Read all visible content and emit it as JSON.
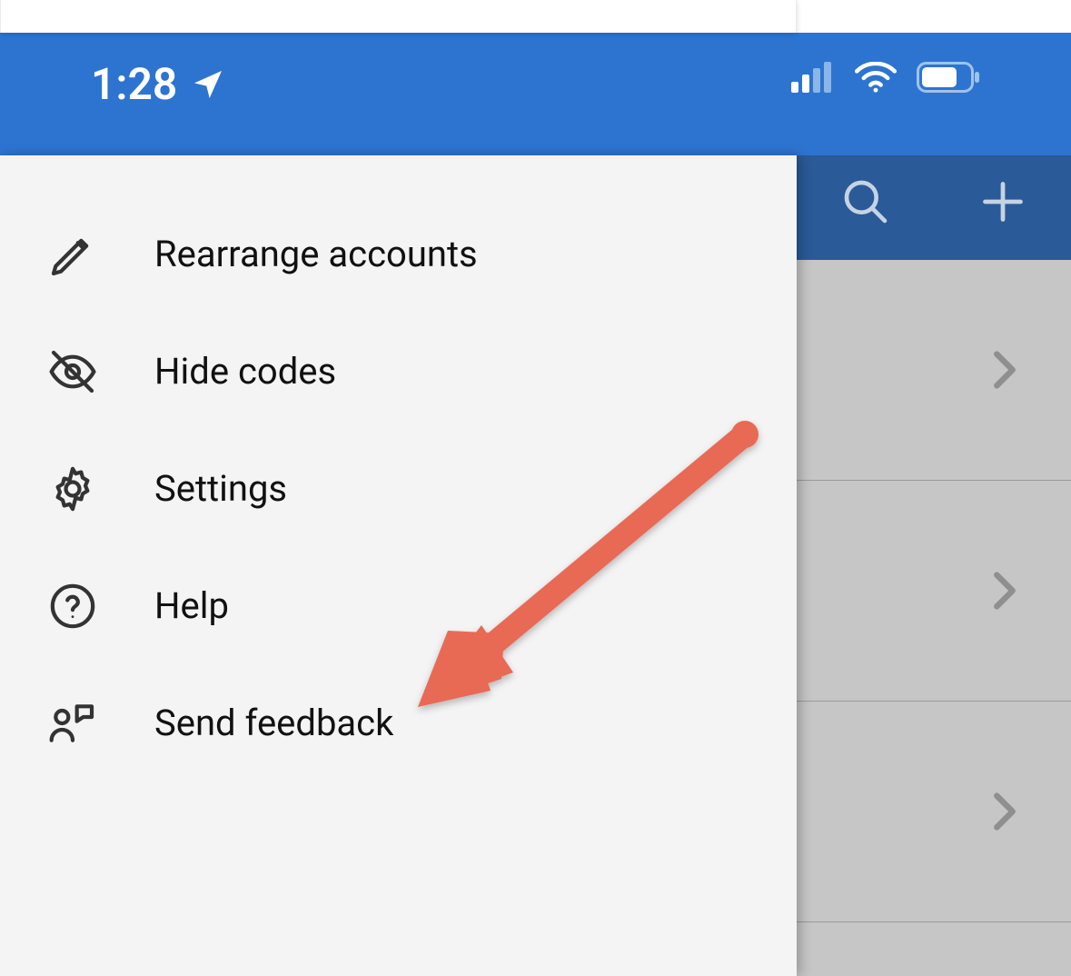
{
  "status_bar": {
    "time": "1:28",
    "location_icon": "location-arrow-icon",
    "signal_icon": "cellular-signal-icon",
    "wifi_icon": "wifi-icon",
    "battery_icon": "battery-icon"
  },
  "header": {
    "search_icon": "search-icon",
    "add_icon": "plus-icon"
  },
  "drawer": {
    "items": [
      {
        "icon": "pencil-icon",
        "label": "Rearrange accounts"
      },
      {
        "icon": "eye-off-icon",
        "label": "Hide codes"
      },
      {
        "icon": "gear-icon",
        "label": "Settings"
      },
      {
        "icon": "question-circle-icon",
        "label": "Help"
      },
      {
        "icon": "feedback-icon",
        "label": "Send feedback"
      }
    ]
  },
  "list": {
    "chevron_icon": "chevron-right-icon"
  },
  "annotation": {
    "arrow_color": "#e86b55",
    "target": "send-feedback"
  }
}
